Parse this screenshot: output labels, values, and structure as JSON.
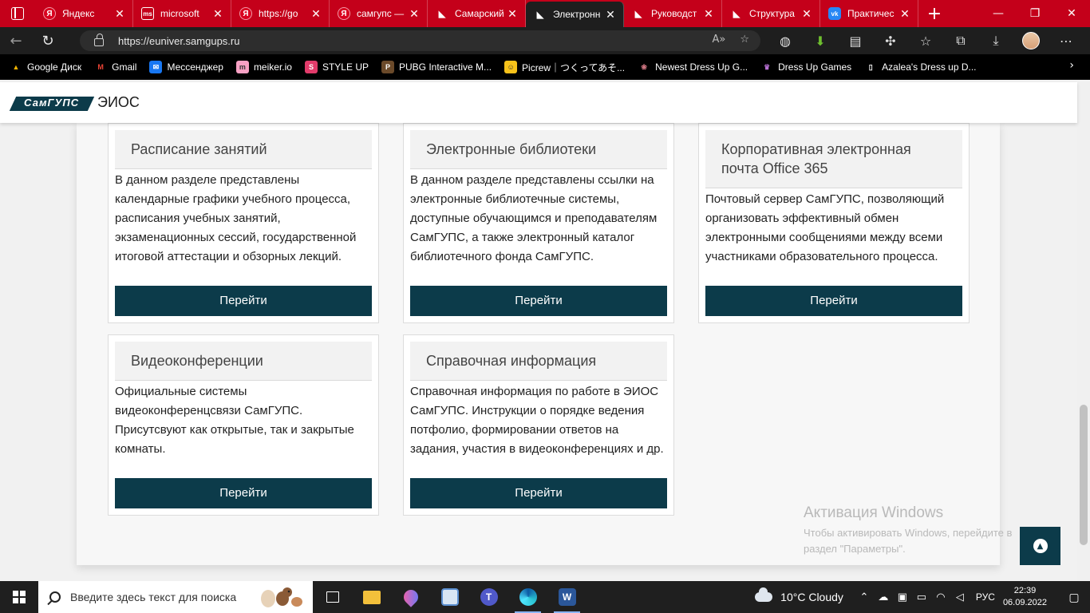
{
  "browser": {
    "tabs": [
      {
        "title": "Яндекс",
        "favicon": "yandex-icon",
        "fav_glyph": "Я",
        "active": false
      },
      {
        "title": "microsoft",
        "favicon": "microsoft-icon",
        "fav_glyph": "ms",
        "active": false
      },
      {
        "title": "https://go",
        "favicon": "yandex-icon",
        "fav_glyph": "Я",
        "active": false
      },
      {
        "title": "самгупс —",
        "favicon": "yandex-icon",
        "fav_glyph": "Я",
        "active": false
      },
      {
        "title": "Самарский",
        "favicon": "samgups-icon",
        "fav_glyph": "◣",
        "active": false
      },
      {
        "title": "Электронн",
        "favicon": "samgups-icon",
        "fav_glyph": "◣",
        "active": true
      },
      {
        "title": "Руководст",
        "favicon": "samgups-icon",
        "fav_glyph": "◣",
        "active": false
      },
      {
        "title": "Структура",
        "favicon": "samgups-icon",
        "fav_glyph": "◣",
        "active": false
      },
      {
        "title": "Практичес",
        "favicon": "vk-icon",
        "fav_glyph": "vk",
        "active": false
      }
    ],
    "url": "https://euniver.samgups.ru",
    "bookmarks": [
      {
        "label": "Google Диск",
        "icon": "google-drive-icon",
        "glyph": "▲",
        "color": "#f4b400"
      },
      {
        "label": "Gmail",
        "icon": "gmail-icon",
        "glyph": "M",
        "color": "#ea4335"
      },
      {
        "label": "Мессенджер",
        "icon": "messenger-icon",
        "glyph": "✉",
        "color": "#1877f2"
      },
      {
        "label": "meiker.io",
        "icon": "meiker-icon",
        "glyph": "m",
        "color": "#f7a1c4"
      },
      {
        "label": "STYLE UP",
        "icon": "styleup-icon",
        "glyph": "S",
        "color": "#e23b6a"
      },
      {
        "label": "PUBG Interactive M...",
        "icon": "pubg-icon",
        "glyph": "P",
        "color": "#6b4a2a"
      },
      {
        "label": "Picrew｜つくってあそ...",
        "icon": "picrew-icon",
        "glyph": "☺",
        "color": "#f7c21a"
      },
      {
        "label": "Newest Dress Up G...",
        "icon": "dressup-icon",
        "glyph": "❀",
        "color": "#d77a86"
      },
      {
        "label": "Dress Up Games",
        "icon": "dressup-games-icon",
        "glyph": "♛",
        "color": "#7a3a8a"
      },
      {
        "label": "Azalea's Dress up D...",
        "icon": "document-icon",
        "glyph": "▯",
        "color": "#000000"
      }
    ]
  },
  "site": {
    "logo_text": "СамГУПС",
    "title": "ЭИОС"
  },
  "cards": [
    {
      "title": "Расписание занятий",
      "body": "В данном разделе представлены календарные графики учебного процесса, расписания учебных занятий, экзаменационных сессий, государственной итоговой аттестации и обзорных лекций.",
      "button": "Перейти"
    },
    {
      "title": "Электронные библиотеки",
      "body": "В данном разделе представлены ссылки на электронные библиотечные системы, доступные обучающимся и преподавателям СамГУПС, а также электронный каталог библиотечного фонда СамГУПС.",
      "button": "Перейти"
    },
    {
      "title": "Корпоративная электронная почта Office 365",
      "body": "Почтовый сервер СамГУПС, позволяющий организовать эффективный обмен электронными сообщениями между всеми участниками образовательного процесса.",
      "button": "Перейти"
    },
    {
      "title": "Видеоконференции",
      "body": "Официальные системы видеоконференцсвязи СамГУПС. Присутсвуют как открытые, так и закрытые комнаты.",
      "button": "Перейти"
    },
    {
      "title": "Справочная информация",
      "body": "Справочная информация по работе в ЭИОС СамГУПС. Инструкции о порядке ведения потфолио, формировании ответов на задания, участия в видеоконференциях и др.",
      "button": "Перейти"
    }
  ],
  "activation": {
    "title": "Активация Windows",
    "text": "Чтобы активировать Windows, перейдите в раздел \"Параметры\"."
  },
  "taskbar": {
    "search_placeholder": "Введите здесь текст для поиска",
    "weather": "10°C  Cloudy",
    "lang": "РУС",
    "time": "22:39",
    "date": "06.09.2022"
  },
  "colors": {
    "tabbar": "#c4001a",
    "accent": "#0c3b4a",
    "taskbar": "#1f1f1f"
  }
}
